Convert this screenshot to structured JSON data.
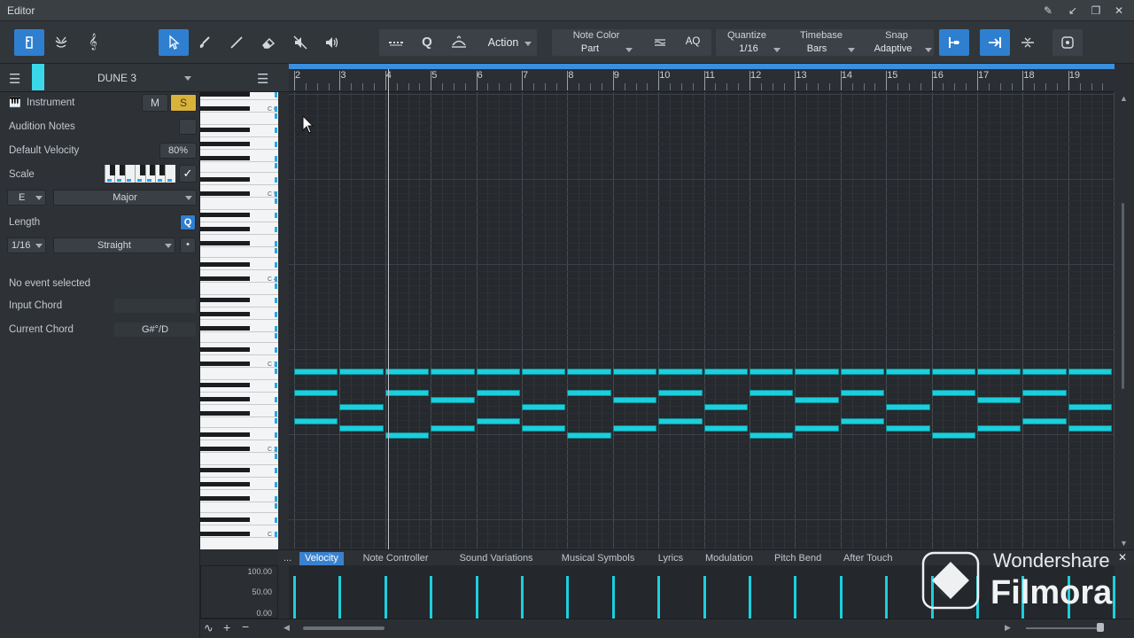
{
  "window": {
    "title": "Editor"
  },
  "toolbar": {
    "action_label": "Action",
    "note_color": {
      "label": "Note Color",
      "value": "Part"
    },
    "aq_label": "AQ",
    "quantize": {
      "label": "Quantize",
      "value": "1/16"
    },
    "timebase": {
      "label": "Timebase",
      "value": "Bars"
    },
    "snap": {
      "label": "Snap",
      "value": "Adaptive"
    }
  },
  "track": {
    "name": "DUNE 3",
    "color": "#3ad7ea"
  },
  "inspector": {
    "instrument_label": "Instrument",
    "mute_label": "M",
    "solo_label": "S",
    "audition_label": "Audition Notes",
    "velocity_label": "Default Velocity",
    "velocity_value": "80%",
    "scale_label": "Scale",
    "scale_root": "E",
    "scale_type": "Major",
    "length_label": "Length",
    "length_q_label": "Q",
    "length_value": "1/16",
    "length_mode": "Straight",
    "no_event": "No event selected",
    "input_chord_label": "Input Chord",
    "input_chord_value": "",
    "current_chord_label": "Current Chord",
    "current_chord_value": "G#°/D"
  },
  "keyboard": {
    "labels": [
      "C 6",
      "C 5",
      "C 4",
      "C 3",
      "C 2",
      "C 1"
    ]
  },
  "ruler": {
    "bars": [
      "2",
      "3",
      "4",
      "5",
      "6",
      "7",
      "8",
      "9",
      "10",
      "11",
      "12",
      "13",
      "14",
      "15",
      "16",
      "17",
      "18",
      "19"
    ]
  },
  "lane": {
    "more_label": "...",
    "tabs": [
      "Velocity",
      "Note Controller",
      "Sound Variations",
      "Musical Symbols",
      "Lyrics",
      "Modulation",
      "Pitch Bend",
      "After Touch"
    ],
    "scale": [
      "100.00",
      "50.00",
      "0.00"
    ]
  },
  "watermark": {
    "line1": "Wondershare",
    "line2": "Filmora"
  },
  "colors": {
    "accent": "#2f7fd0",
    "note": "#1ccfdc",
    "solo": "#d8b23a"
  }
}
